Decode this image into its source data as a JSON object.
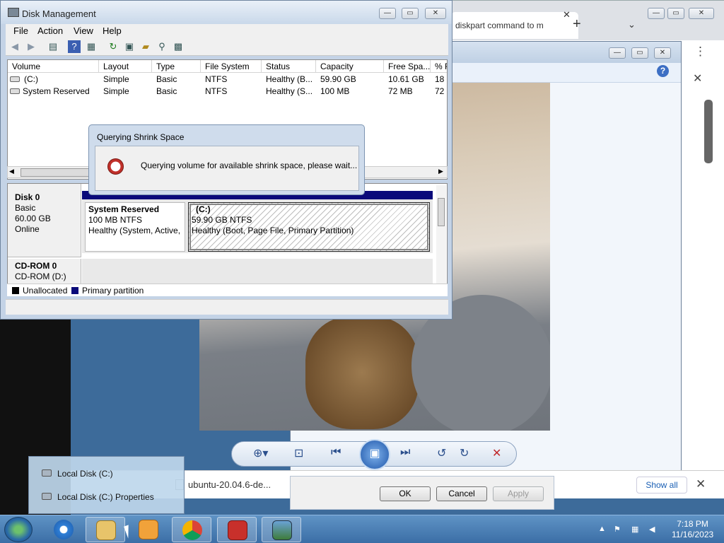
{
  "disk_mgmt": {
    "title": "Disk Management",
    "menu": [
      "File",
      "Action",
      "View",
      "Help"
    ],
    "columns": [
      "Volume",
      "Layout",
      "Type",
      "File System",
      "Status",
      "Capacity",
      "Free Spa...",
      "% F"
    ],
    "rows": [
      {
        "volume": "(C:)",
        "layout": "Simple",
        "type": "Basic",
        "fs": "NTFS",
        "status": "Healthy (B...",
        "capacity": "59.90 GB",
        "free": "10.61 GB",
        "pct": "18"
      },
      {
        "volume": "System Reserved",
        "layout": "Simple",
        "type": "Basic",
        "fs": "NTFS",
        "status": "Healthy (S...",
        "capacity": "100 MB",
        "free": "72 MB",
        "pct": "72"
      }
    ],
    "disk0": {
      "name": "Disk 0",
      "type": "Basic",
      "size": "60.00 GB",
      "state": "Online"
    },
    "partitions": [
      {
        "name": "System Reserved",
        "size": "100 MB NTFS",
        "status": "Healthy (System, Active,"
      },
      {
        "name": "(C:)",
        "size": "59.90 GB NTFS",
        "status": "Healthy (Boot, Page File, Primary Partition)"
      }
    ],
    "cdrom": {
      "name": "CD-ROM 0",
      "drive": "CD-ROM (D:)"
    },
    "legend": {
      "unallocated": "Unallocated",
      "primary": "Primary partition"
    },
    "colors": {
      "primary": "#0a0a7a",
      "unallocated": "#000000"
    }
  },
  "shrink_dialog": {
    "title": "Querying Shrink Space",
    "message": "Querying volume for available shrink space, please wait..."
  },
  "chrome": {
    "tab_title": "diskpart command to m"
  },
  "properties": {
    "ok": "OK",
    "cancel": "Cancel",
    "apply": "Apply"
  },
  "download_bar": {
    "file": "ubuntu-20.04.6-de...",
    "show_all": "Show all"
  },
  "jumplist": {
    "items": [
      "Local Disk (C:)",
      "Local Disk (C:) Properties"
    ]
  },
  "taskbar": {
    "time": "7:18 PM",
    "date": "11/16/2023"
  }
}
